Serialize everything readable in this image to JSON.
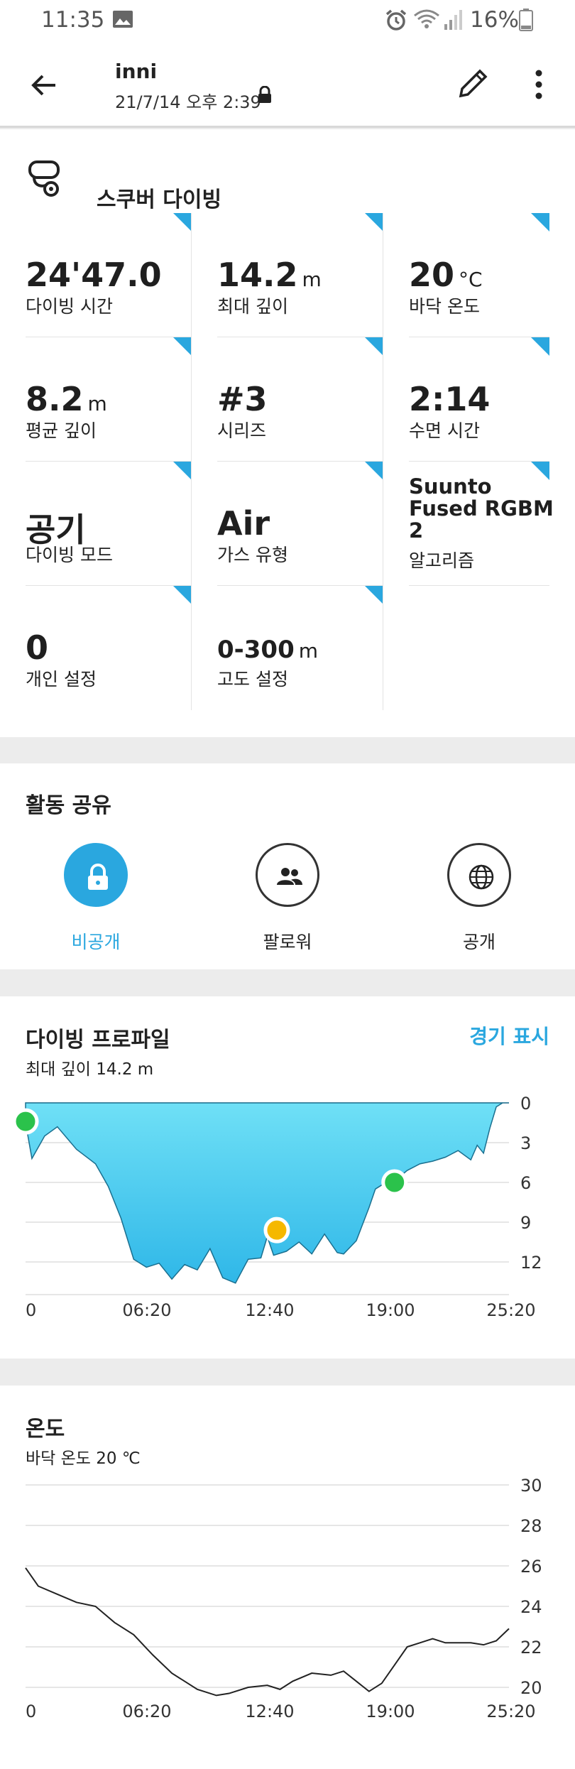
{
  "status_bar": {
    "time": "11:35",
    "battery": "16%"
  },
  "header": {
    "title": "inni",
    "subtitle": "21/7/14 오후 2:39"
  },
  "activity": {
    "name": "스쿠버 다이빙"
  },
  "stats": [
    {
      "value": "24'47.0",
      "unit": "",
      "label": "다이빙 시간"
    },
    {
      "value": "14.2",
      "unit": "m",
      "label": "최대 깊이"
    },
    {
      "value": "20",
      "unit": "°C",
      "label": "바닥 온도"
    },
    {
      "value": "8.2",
      "unit": "m",
      "label": "평균 깊이"
    },
    {
      "value": "#3",
      "unit": "",
      "label": "시리즈"
    },
    {
      "value": "2:14",
      "unit": "",
      "label": "수면 시간"
    },
    {
      "value": "공기",
      "unit": "",
      "label": "다이빙 모드"
    },
    {
      "value": "Air",
      "unit": "",
      "label": "가스 유형"
    },
    {
      "value": "Suunto Fused RGBM 2",
      "unit": "",
      "label": "알고리즘"
    },
    {
      "value": "0",
      "unit": "",
      "label": "개인 설정"
    },
    {
      "value": "0-300",
      "unit": "m",
      "label": "고도 설정"
    }
  ],
  "sharing": {
    "title": "활동 공유",
    "options": [
      {
        "label": "비공개",
        "icon": "lock-icon",
        "active": true
      },
      {
        "label": "팔로워",
        "icon": "people-icon",
        "active": false
      },
      {
        "label": "공개",
        "icon": "globe-icon",
        "active": false
      }
    ]
  },
  "profile": {
    "title": "다이빙 프로파일",
    "link": "경기 표시",
    "subtitle": "최대 깊이 14.2 m"
  },
  "temperature": {
    "title": "온도",
    "subtitle": "바닥 온도 20 ℃"
  },
  "colors": {
    "accent": "#2aa7df",
    "depth_fill": "#4cc9ee",
    "marker_green": "#2bc24b",
    "marker_yellow": "#f5b800"
  },
  "chart_data": [
    {
      "type": "area",
      "title": "다이빙 프로파일",
      "x_unit": "mm:ss",
      "x_ticks": [
        "0",
        "06:20",
        "12:40",
        "19:00",
        "25:20"
      ],
      "y_ticks": [
        "0",
        "3",
        "6",
        "9",
        "12"
      ],
      "y_inverted": true,
      "ylim": [
        0,
        14.2
      ],
      "xlim": [
        0,
        1520
      ],
      "series": [
        {
          "x": [
            0,
            20,
            60,
            100,
            160,
            220,
            260,
            300,
            340,
            380,
            420,
            460,
            500,
            540,
            580,
            620,
            660,
            700,
            740,
            760,
            780,
            820,
            860,
            900,
            940,
            980,
            1000,
            1040,
            1080,
            1100,
            1140,
            1180,
            1200,
            1240,
            1280,
            1320,
            1360,
            1400,
            1420,
            1440,
            1460,
            1480,
            1500,
            1520
          ],
          "y": [
            1.5,
            4.2,
            2.5,
            1.8,
            3.5,
            4.6,
            6.3,
            8.7,
            11.8,
            12.4,
            12.1,
            13.3,
            12.2,
            12.6,
            11.0,
            13.2,
            13.6,
            11.8,
            11.7,
            10.1,
            11.5,
            11.2,
            10.5,
            11.4,
            9.9,
            11.3,
            11.4,
            10.4,
            7.9,
            6.5,
            5.9,
            5.5,
            5.1,
            4.6,
            4.4,
            4.1,
            3.6,
            4.3,
            3.2,
            3.8,
            1.9,
            0.3,
            0,
            0
          ]
        }
      ],
      "markers": [
        {
          "x": 0,
          "y": 1.4,
          "color": "green"
        },
        {
          "x": 790,
          "y": 9.6,
          "color": "yellow"
        },
        {
          "x": 1160,
          "y": 6.0,
          "color": "green"
        }
      ]
    },
    {
      "type": "line",
      "title": "온도",
      "x_ticks": [
        "0",
        "06:20",
        "12:40",
        "19:00",
        "25:20"
      ],
      "y_ticks": [
        "30",
        "28",
        "26",
        "24",
        "22",
        "20"
      ],
      "ylim": [
        19,
        31
      ],
      "xlim": [
        0,
        1520
      ],
      "series": [
        {
          "x": [
            0,
            40,
            100,
            160,
            220,
            280,
            340,
            400,
            460,
            500,
            540,
            600,
            640,
            700,
            760,
            800,
            840,
            900,
            960,
            1000,
            1040,
            1080,
            1120,
            1160,
            1200,
            1240,
            1280,
            1320,
            1360,
            1400,
            1440,
            1480,
            1520
          ],
          "y": [
            25.9,
            25.0,
            24.6,
            24.2,
            24.0,
            23.2,
            22.6,
            21.6,
            20.7,
            20.3,
            19.9,
            19.6,
            19.7,
            20.0,
            20.1,
            19.9,
            20.3,
            20.7,
            20.6,
            20.8,
            20.3,
            19.8,
            20.2,
            21.1,
            22.0,
            22.2,
            22.4,
            22.2,
            22.2,
            22.2,
            22.1,
            22.3,
            22.9
          ]
        }
      ]
    }
  ]
}
